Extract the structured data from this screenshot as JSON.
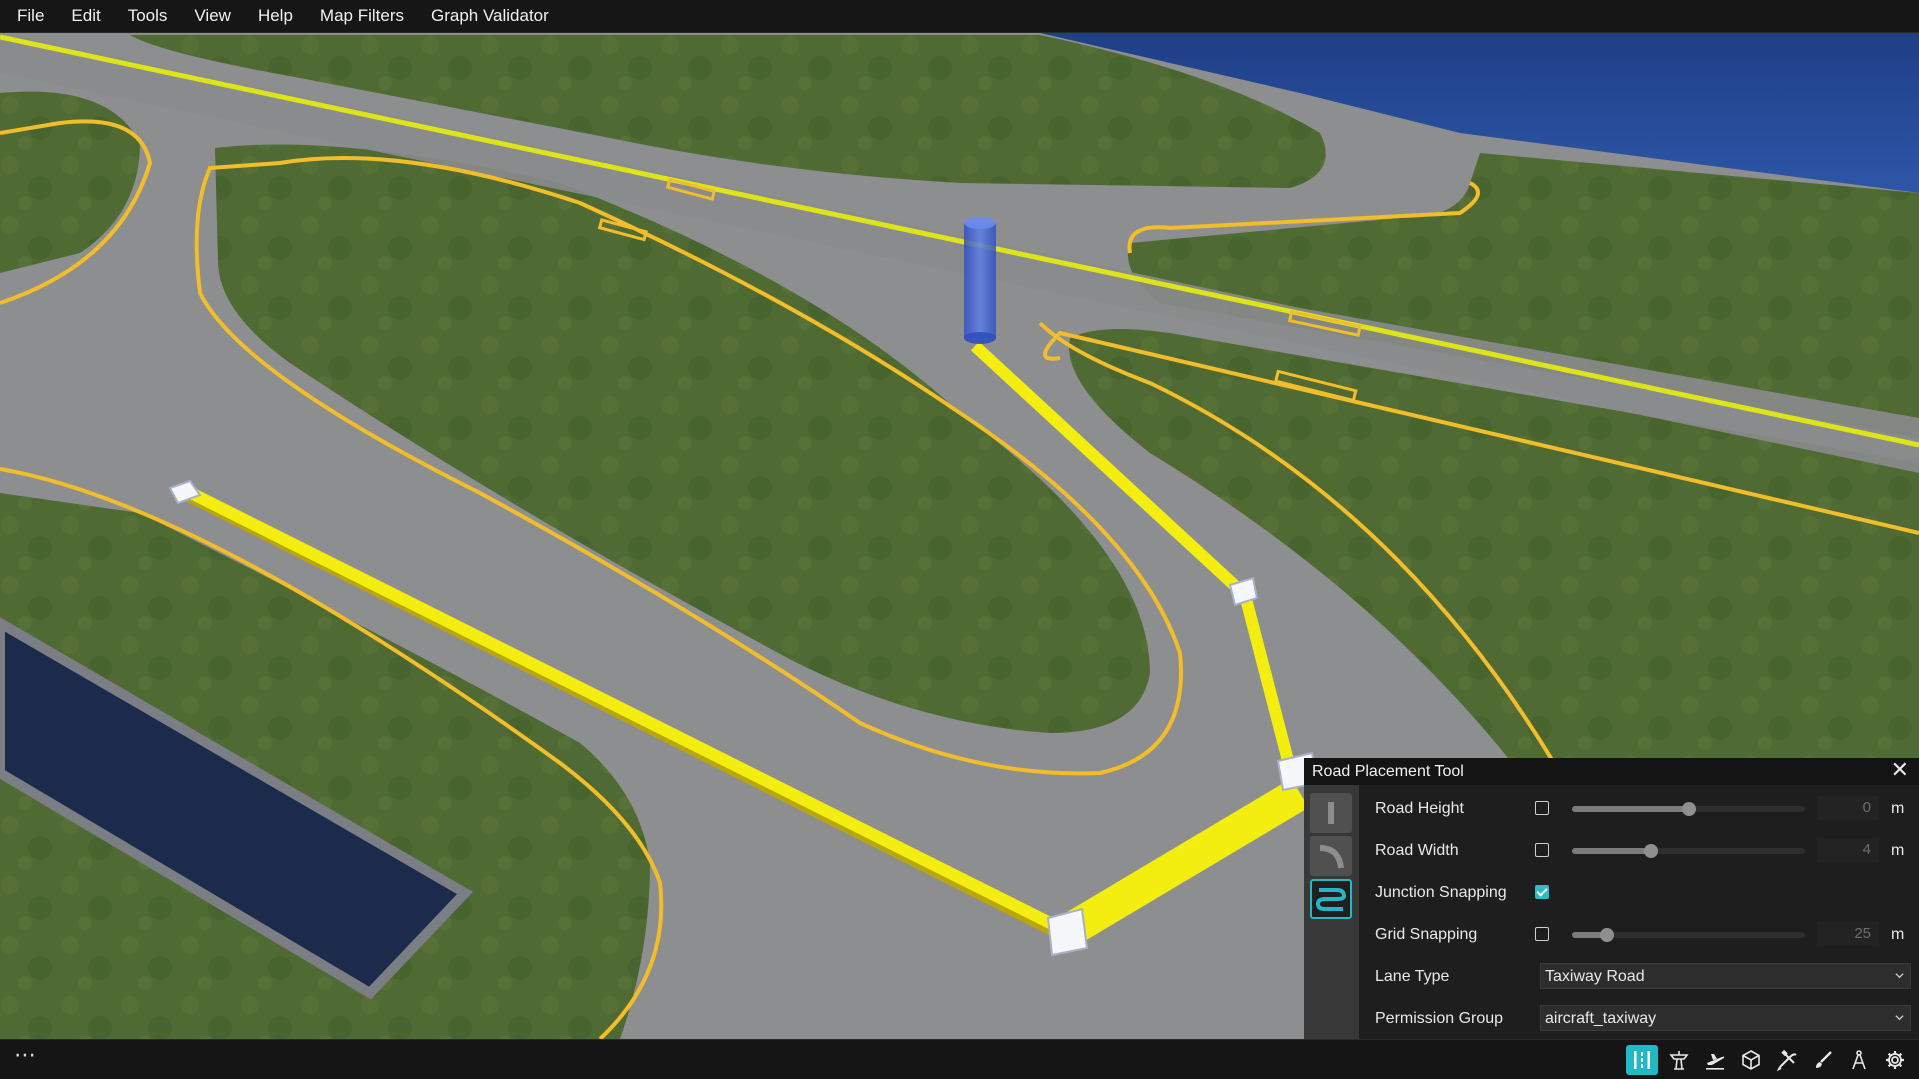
{
  "menu": {
    "items": [
      "File",
      "Edit",
      "Tools",
      "View",
      "Help",
      "Map Filters",
      "Graph Validator"
    ]
  },
  "viewport": {
    "colors": {
      "tarmac": "#8f9090",
      "grass": "#4f6a33",
      "water": "#1b2a4a",
      "sky": "#23438a",
      "marking_yellow": "#f3c12d",
      "placed_road": "#f3ee10",
      "anchor_cylinder": "#3d5fd0"
    }
  },
  "status_bar": {
    "more_label": "⋯",
    "tools": [
      {
        "name": "road-placement-tool-icon",
        "active": true
      },
      {
        "name": "airport-tower-icon",
        "active": false
      },
      {
        "name": "airplane-takeoff-icon",
        "active": false
      },
      {
        "name": "cube-icon",
        "active": false
      },
      {
        "name": "tools-icon",
        "active": false
      },
      {
        "name": "brush-icon",
        "active": false
      },
      {
        "name": "compass-icon",
        "active": false
      },
      {
        "name": "gear-icon",
        "active": false
      }
    ]
  },
  "road_placement_tool": {
    "title": "Road Placement Tool",
    "close_label": "✕",
    "modes": [
      {
        "name": "straight-road-icon",
        "active": false
      },
      {
        "name": "curved-road-icon",
        "active": false
      },
      {
        "name": "spline-road-icon",
        "active": true
      }
    ],
    "road_height": {
      "label": "Road Height",
      "checked": false,
      "value": "0",
      "unit": "m",
      "slider_fraction": 0.5
    },
    "road_width": {
      "label": "Road Width",
      "checked": false,
      "value": "4",
      "unit": "m",
      "slider_fraction": 0.34
    },
    "junction_snapping": {
      "label": "Junction Snapping",
      "checked": true
    },
    "grid_snapping": {
      "label": "Grid Snapping",
      "checked": false,
      "value": "25",
      "unit": "m",
      "slider_fraction": 0.15
    },
    "lane_type": {
      "label": "Lane Type",
      "value": "Taxiway Road"
    },
    "permission_group": {
      "label": "Permission Group",
      "value": "aircraft_taxiway"
    }
  }
}
